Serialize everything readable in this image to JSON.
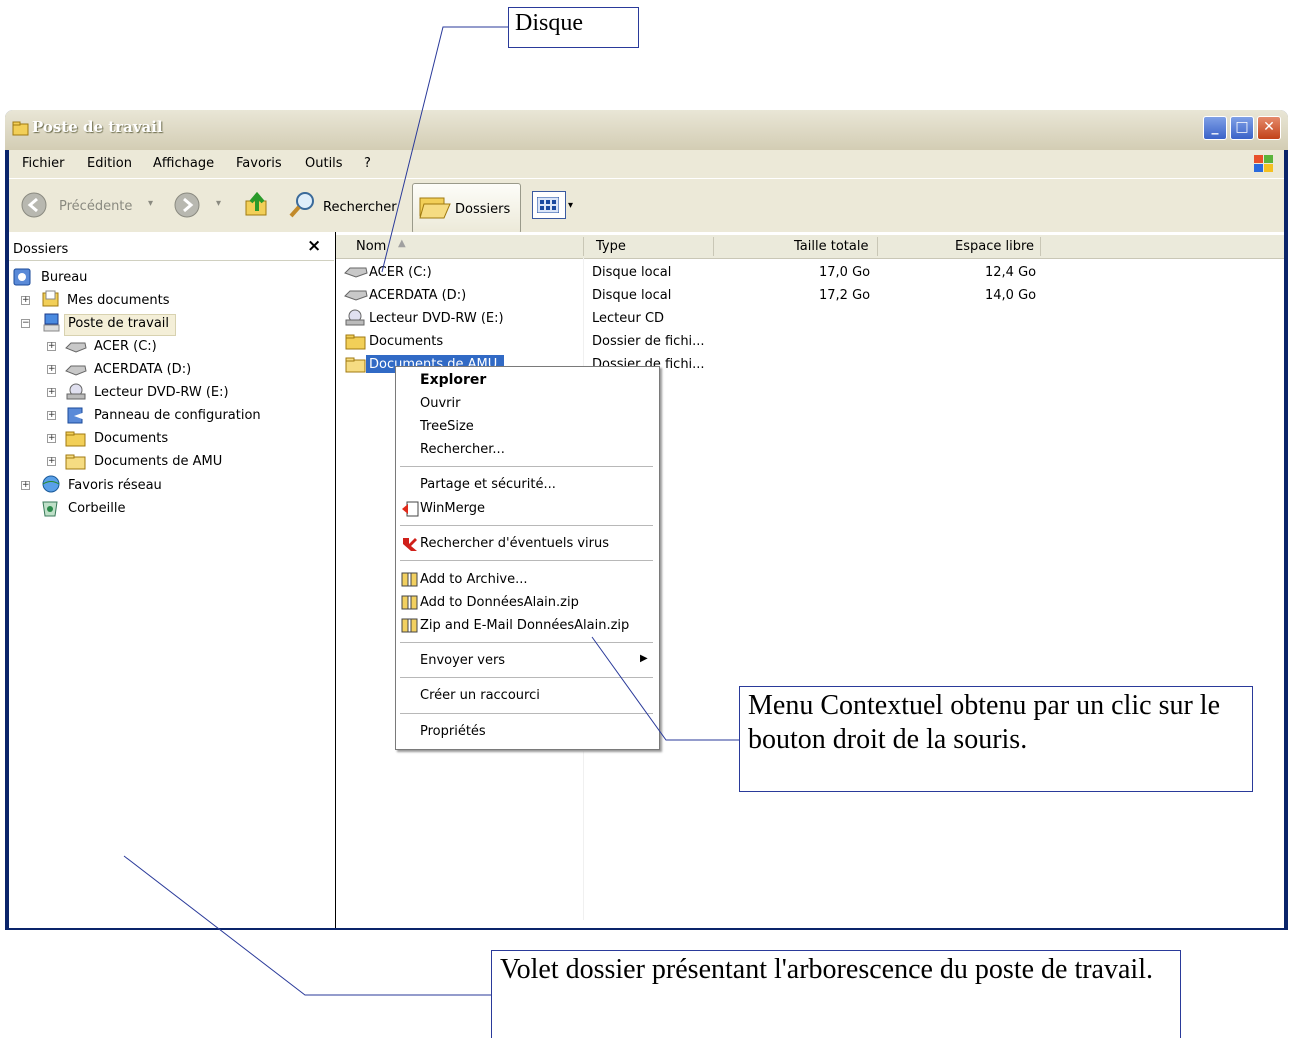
{
  "callouts": {
    "disque": "Disque",
    "menu": "Menu Contextuel obtenu par un clic sur le bouton droit de la souris.",
    "volet": "Volet dossier présentant l'arborescence du poste de travail."
  },
  "window": {
    "title": "Poste de travail",
    "controls": {
      "minimize": "_",
      "maximize": "□",
      "close": "✕"
    }
  },
  "menubar": [
    "Fichier",
    "Edition",
    "Affichage",
    "Favoris",
    "Outils",
    "?"
  ],
  "toolbar": {
    "back": "Précédente",
    "search": "Rechercher",
    "folders": "Dossiers"
  },
  "left_panel": {
    "title": "Dossiers",
    "close": "×",
    "tree": [
      "Bureau",
      "Mes documents",
      "Poste de travail",
      "ACER (C:)",
      "ACERDATA (D:)",
      "Lecteur DVD-RW (E:)",
      "Panneau de configuration",
      "Documents",
      "Documents de AMU",
      "Favoris réseau",
      "Corbeille"
    ]
  },
  "columns": [
    "Nom",
    "Type",
    "Taille totale",
    "Espace libre"
  ],
  "rows": [
    {
      "name": "ACER (C:)",
      "type": "Disque local",
      "size": "17,0 Go",
      "free": "12,4 Go"
    },
    {
      "name": "ACERDATA (D:)",
      "type": "Disque local",
      "size": "17,2 Go",
      "free": "14,0 Go"
    },
    {
      "name": "Lecteur DVD-RW (E:)",
      "type": "Lecteur CD",
      "size": "",
      "free": ""
    },
    {
      "name": "Documents",
      "type": "Dossier de fichi...",
      "size": "",
      "free": ""
    },
    {
      "name": "Documents de AMU",
      "type": "Dossier de fichi...",
      "size": "",
      "free": ""
    }
  ],
  "context_menu": [
    "Explorer",
    "Ouvrir",
    "TreeSize",
    "Rechercher...",
    "Partage et sécurité...",
    "WinMerge",
    "Rechercher d'éventuels virus",
    "Add to Archive...",
    "Add to DonnéesAlain.zip",
    "Zip and E-Mail DonnéesAlain.zip",
    "Envoyer vers",
    "Créer un raccourci",
    "Propriétés"
  ],
  "colors": {
    "xp_blue": "#0a246a",
    "chrome": "#ece9d8",
    "callout_border": "#2a3a9a"
  }
}
